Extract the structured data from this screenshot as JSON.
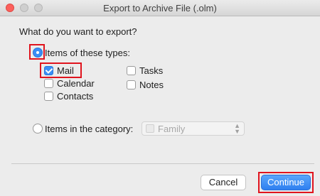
{
  "window": {
    "title": "Export to Archive File (.olm)"
  },
  "question": "What do you want to export?",
  "options": {
    "items_of_types": {
      "label": "Items of these types:",
      "selected": true
    },
    "items_in_category": {
      "label": "Items in the category:",
      "selected": false
    }
  },
  "types": {
    "mail": {
      "label": "Mail",
      "checked": true
    },
    "calendar": {
      "label": "Calendar",
      "checked": false
    },
    "contacts": {
      "label": "Contacts",
      "checked": false
    },
    "tasks": {
      "label": "Tasks",
      "checked": false
    },
    "notes": {
      "label": "Notes",
      "checked": false
    }
  },
  "category_select": {
    "value": "Family",
    "disabled": true
  },
  "buttons": {
    "cancel": "Cancel",
    "continue": "Continue"
  },
  "colors": {
    "accent": "#3a8ef5",
    "highlight": "#e0141e"
  }
}
